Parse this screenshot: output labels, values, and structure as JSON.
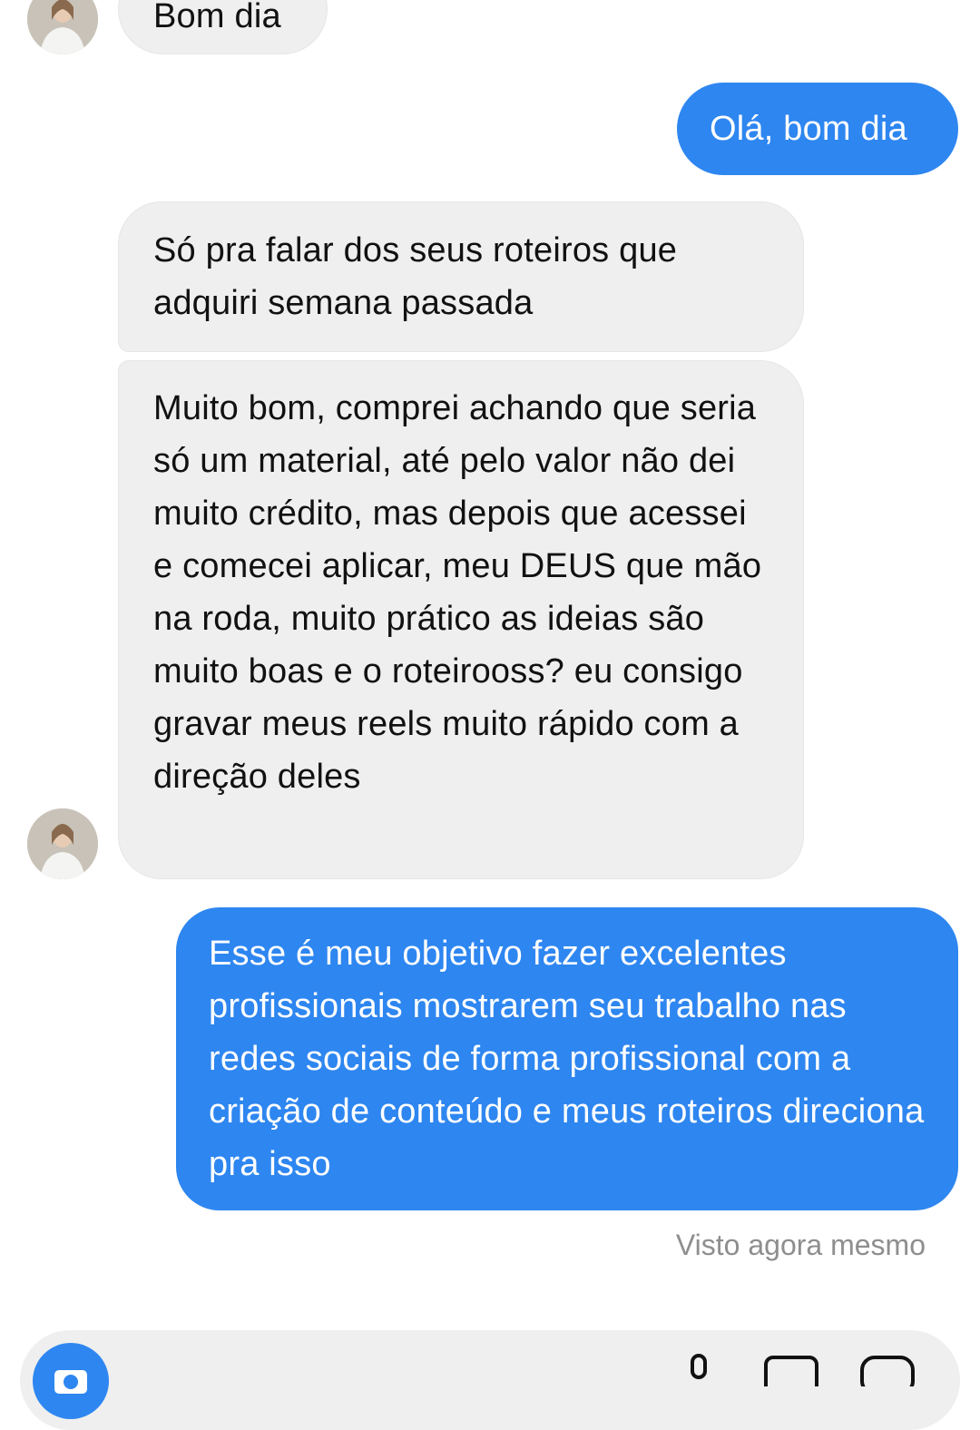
{
  "messages": [
    {
      "sender": "them",
      "text": "Bom dia"
    },
    {
      "sender": "me",
      "text": "Olá, bom dia"
    },
    {
      "sender": "them",
      "text": "Só pra falar dos seus roteiros que adquiri semana passada"
    },
    {
      "sender": "them",
      "text": "Muito bom, comprei achando que seria só um material, até pelo valor não dei muito crédito, mas depois que acessei e comecei aplicar, meu DEUS que mão na roda, muito prático as ideias são muito boas e o roteirooss? eu consigo gravar meus reels muito rápido com a direção deles"
    },
    {
      "sender": "me",
      "text": "Esse é meu objetivo fazer excelentes profissionais mostrarem seu trabalho nas redes sociais de forma profissional com a criação de conteúdo e meus roteiros direciona pra isso"
    }
  ],
  "seen_status": "Visto agora mesmo",
  "colors": {
    "outgoing_bubble": "#2e86f0",
    "incoming_bubble": "#efefef",
    "seen_text": "#8e8e8e"
  },
  "composer": {
    "icons": [
      "camera-icon",
      "microphone-icon",
      "image-icon",
      "sticker-icon"
    ]
  }
}
